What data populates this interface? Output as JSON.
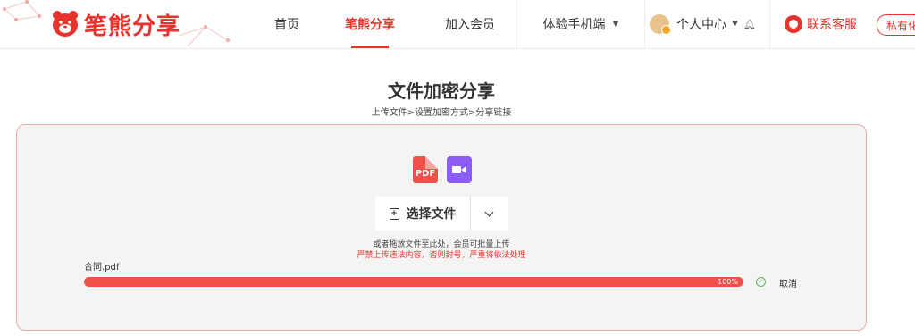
{
  "header": {
    "logo_text": "笔熊分享",
    "nav": [
      {
        "label": "首页",
        "active": false
      },
      {
        "label": "笔熊分享",
        "active": true
      },
      {
        "label": "加入会员",
        "active": false
      },
      {
        "label": "体验手机端",
        "active": false,
        "has_dropdown": true
      }
    ],
    "user_center_label": "个人中心",
    "support_label": "联系客服",
    "private_tag_label": "私有化"
  },
  "page": {
    "title": "文件加密分享",
    "breadcrumb": "上传文件>设置加密方式>分享链接"
  },
  "upload": {
    "file_type_icons": [
      "pdf-icon",
      "video-icon"
    ],
    "pdf_icon_text": "PDF",
    "select_button_label": "选择文件",
    "drag_hint": "或者拖放文件至此处，会员可批量上传",
    "warning": "严禁上传违法内容，否则封号，严重将依法处理",
    "file": {
      "name": "合同.pdf",
      "progress": 100,
      "progress_text": "100%",
      "cancel_label": "取消"
    }
  },
  "colors": {
    "brand": "#e8322c",
    "progress_fill": "#f0504a",
    "panel_bg": "#f4f4f4",
    "panel_border": "#f1a9a5",
    "video_icon": "#8b5cf6",
    "success": "#5cb85c"
  }
}
